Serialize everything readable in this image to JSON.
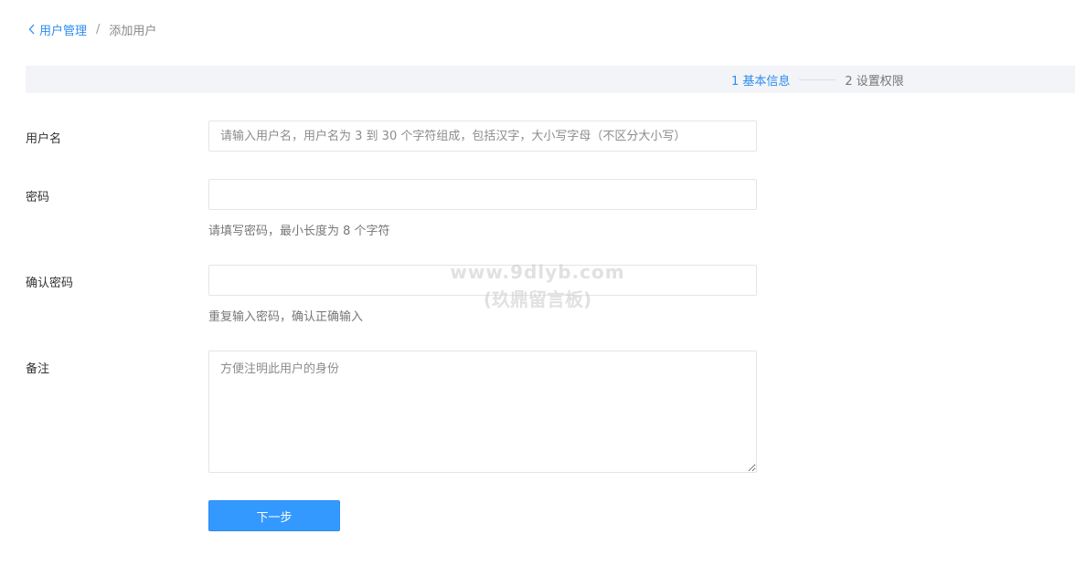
{
  "breadcrumb": {
    "back_label": "用户管理",
    "separator": "/",
    "current": "添加用户"
  },
  "steps": [
    {
      "label": "1 基本信息",
      "active": true
    },
    {
      "label": "2 设置权限",
      "active": false
    }
  ],
  "form": {
    "username": {
      "label": "用户名",
      "placeholder": "请输入用户名，用户名为 3 到 30 个字符组成，包括汉字，大小写字母（不区分大小写）",
      "value": ""
    },
    "password": {
      "label": "密码",
      "value": "",
      "help": "请填写密码，最小长度为 8 个字符"
    },
    "confirm_password": {
      "label": "确认密码",
      "value": "",
      "help": "重复输入密码，确认正确输入"
    },
    "remark": {
      "label": "备注",
      "placeholder": "方便注明此用户的身份",
      "value": ""
    }
  },
  "actions": {
    "next_label": "下一步"
  },
  "watermark": {
    "line1": "www.9dlyb.com",
    "line2": "(玖鼎留言板)"
  },
  "colors": {
    "accent": "#2d8cf0",
    "button": "#3399ff",
    "steps_bg": "#f3f4f7"
  },
  "icons": {
    "back": "chevron-left-icon"
  }
}
